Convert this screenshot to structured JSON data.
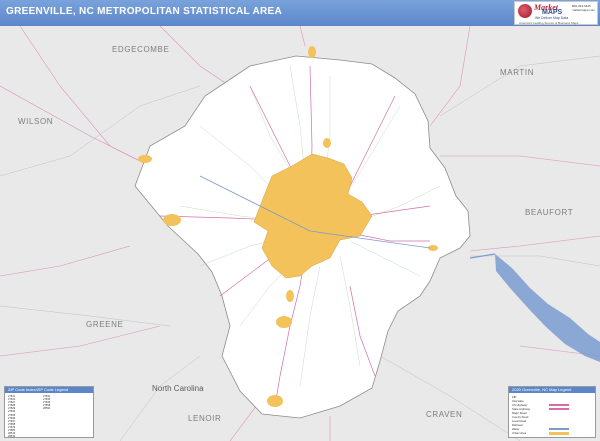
{
  "header": {
    "title": "GREENVILLE, NC METROPOLITAN STATISTICAL AREA"
  },
  "logo": {
    "brand": "Market",
    "brand2": "MAPS",
    "tagline": "We Deliver Map Data",
    "tagline2": "America's Leading Source of Business Maps",
    "info": "800-334-3425\nmarketmaps.com"
  },
  "county_labels": [
    "EDGECOMBE",
    "WILSON",
    "MARTIN",
    "BEAUFORT",
    "GREENE",
    "LENOIR",
    "CRAVEN"
  ],
  "state_label": "North Carolina",
  "colors": {
    "header": "#5b86c9",
    "urban": "#f3c25b",
    "county_fill": "#ffffff",
    "outside": "#e8e8e8",
    "water": "#6b8fc9"
  },
  "legend_left": {
    "header": "ZIP Code Index/ZIP Code Legend",
    "rows_left": [
      "27811",
      "27812",
      "27827",
      "27828",
      "27829",
      "27834",
      "27835",
      "27836",
      "27837",
      "27858",
      "27879",
      "27884",
      "28513",
      "28530",
      "28590"
    ],
    "rows_right": [
      "27834",
      "27835",
      "27836",
      "27858",
      "28590"
    ]
  },
  "legend_right": {
    "header": "2020 Greenville, NC Map Legend",
    "items": [
      "ZIP",
      "Interstate",
      "US Highway",
      "State Highway",
      "Major Road",
      "County Road",
      "Local Road",
      "Railroad",
      "Water",
      "Urban Area",
      "County Boundary",
      "State Boundary"
    ]
  }
}
